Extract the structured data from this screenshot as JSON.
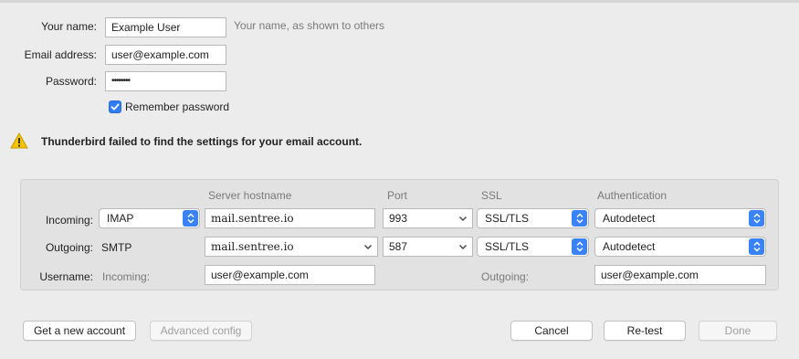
{
  "identity": {
    "name_label": "Your name:",
    "name_value": "Example User",
    "name_hint": "Your name, as shown to others",
    "email_label": "Email address:",
    "email_value": "user@example.com",
    "password_label": "Password:",
    "password_value": "••••••••",
    "remember_label": "Remember password",
    "remember_checked": true
  },
  "warning": {
    "icon": "warning-triangle-icon",
    "text": "Thunderbird failed to find the settings for your email account."
  },
  "server_settings": {
    "headers": {
      "hostname": "Server hostname",
      "port": "Port",
      "ssl": "SSL",
      "auth": "Authentication"
    },
    "incoming": {
      "label": "Incoming:",
      "protocol": "IMAP",
      "hostname": "mail.sentree.io",
      "port": "993",
      "ssl": "SSL/TLS",
      "auth": "Autodetect"
    },
    "outgoing": {
      "label": "Outgoing:",
      "protocol": "SMTP",
      "hostname": "mail.sentree.io",
      "port": "587",
      "ssl": "SSL/TLS",
      "auth": "Autodetect"
    },
    "username": {
      "label": "Username:",
      "incoming_label": "Incoming:",
      "incoming_value": "user@example.com",
      "outgoing_label": "Outgoing:",
      "outgoing_value": "user@example.com"
    }
  },
  "buttons": {
    "new_account": "Get a new account",
    "advanced": "Advanced config",
    "cancel": "Cancel",
    "retest": "Re-test",
    "done": "Done"
  },
  "colors": {
    "accent": "#3a82f7",
    "warning": "#f5c400"
  }
}
